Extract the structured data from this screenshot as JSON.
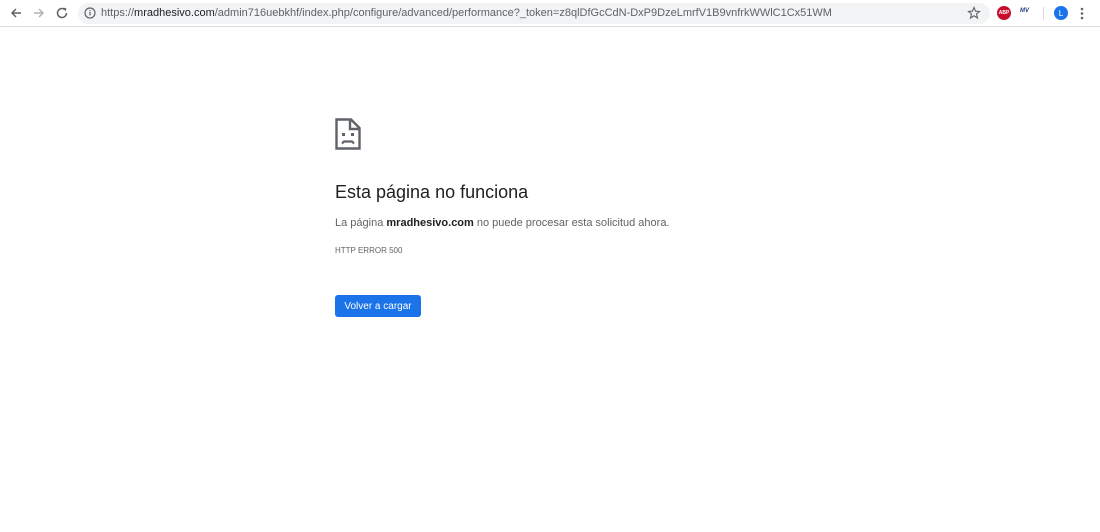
{
  "browser": {
    "url_scheme": "https://",
    "url_host": "mradhesivo.com",
    "url_path": "/admin716uebkhf/index.php/configure/advanced/performance?_token=z8qlDfGcCdN-DxP9DzeLmrfV1B9vnfrkWWlC1Cx51WM",
    "extensions": {
      "abp_label": "ABP",
      "mv_label": "MV"
    },
    "profile_initial": "L"
  },
  "error_page": {
    "heading": "Esta página no funciona",
    "message_prefix": "La página ",
    "message_host": "mradhesivo.com",
    "message_suffix": " no puede procesar esta solicitud ahora.",
    "error_code": "HTTP ERROR 500",
    "reload_label": "Volver a cargar"
  },
  "colors": {
    "accent": "#1a73e8",
    "text_primary": "#202124",
    "text_secondary": "#5f6368",
    "abp_red": "#c70d2c"
  }
}
